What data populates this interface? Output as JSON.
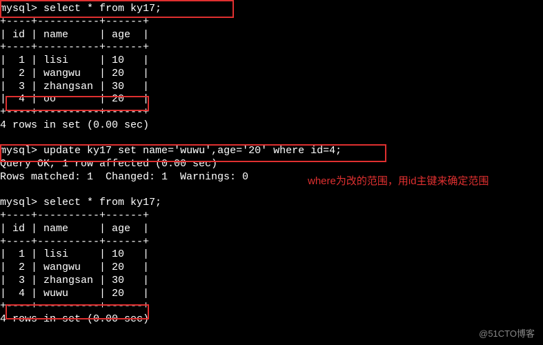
{
  "prompt": "mysql>",
  "cmd1": "select * from ky17;",
  "table1": {
    "sep": "+----+----------+------+",
    "header": "| id | name     | age  |",
    "rows": [
      "|  1 | lisi     | 10   |",
      "|  2 | wangwu   | 20   |",
      "|  3 | zhangsan | 30   |",
      "|  4 | oo       | 20   |"
    ]
  },
  "result1": "4 rows in set (0.00 sec)",
  "blank": " ",
  "cmd2": "update ky17 set name='wuwu',age='20' where id=4;",
  "result2a": "Query OK, 1 row affected (0.00 sec)",
  "result2b": "Rows matched: 1  Changed: 1  Warnings: 0",
  "cmd3": "select * from ky17;",
  "table2": {
    "sep": "+----+----------+------+",
    "header": "| id | name     | age  |",
    "rows": [
      "|  1 | lisi     | 10   |",
      "|  2 | wangwu   | 20   |",
      "|  3 | zhangsan | 30   |",
      "|  4 | wuwu     | 20   |"
    ]
  },
  "result3": "4 rows in set (0.00 sec)",
  "annotation_text": "where为改的范围，用id主键来确定范围",
  "watermark_text": "@51CTO博客"
}
